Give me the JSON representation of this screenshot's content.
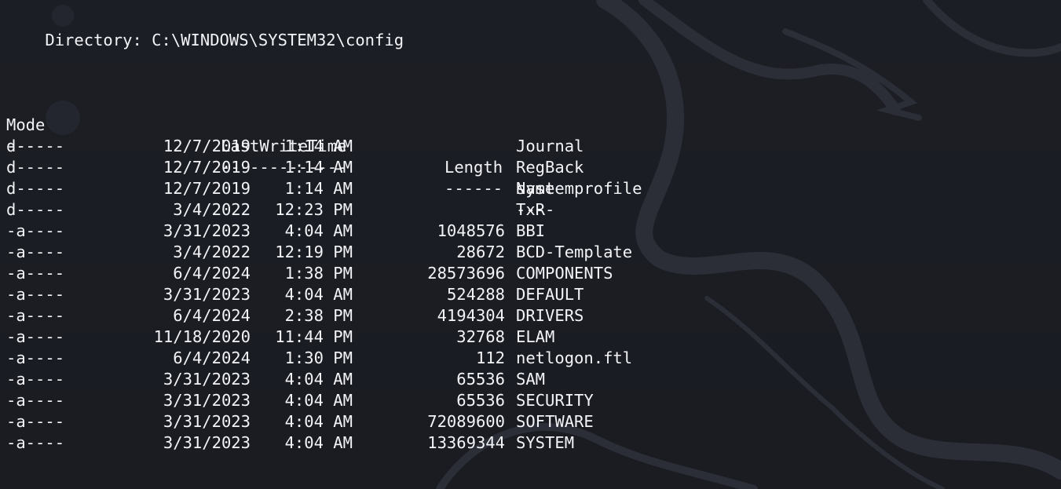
{
  "directory_line": {
    "label": "Directory:",
    "path": "C:\\WINDOWS\\SYSTEM32\\config"
  },
  "headers": {
    "mode": "Mode",
    "lastwritetime": "LastWriteTime",
    "length": "Length",
    "name": "Name"
  },
  "underlines": {
    "mode": "----",
    "lastwritetime": "-------------",
    "length": "------",
    "name": "----"
  },
  "rows": [
    {
      "mode": "d-----",
      "date": "12/7/2019",
      "time": "1:14 AM",
      "length": "",
      "name": "Journal"
    },
    {
      "mode": "d-----",
      "date": "12/7/2019",
      "time": "1:14 AM",
      "length": "",
      "name": "RegBack"
    },
    {
      "mode": "d-----",
      "date": "12/7/2019",
      "time": "1:14 AM",
      "length": "",
      "name": "systemprofile"
    },
    {
      "mode": "d-----",
      "date": "3/4/2022",
      "time": "12:23 PM",
      "length": "",
      "name": "TxR"
    },
    {
      "mode": "-a----",
      "date": "3/31/2023",
      "time": "4:04 AM",
      "length": "1048576",
      "name": "BBI"
    },
    {
      "mode": "-a----",
      "date": "3/4/2022",
      "time": "12:19 PM",
      "length": "28672",
      "name": "BCD-Template"
    },
    {
      "mode": "-a----",
      "date": "6/4/2024",
      "time": "1:38 PM",
      "length": "28573696",
      "name": "COMPONENTS"
    },
    {
      "mode": "-a----",
      "date": "3/31/2023",
      "time": "4:04 AM",
      "length": "524288",
      "name": "DEFAULT"
    },
    {
      "mode": "-a----",
      "date": "6/4/2024",
      "time": "2:38 PM",
      "length": "4194304",
      "name": "DRIVERS"
    },
    {
      "mode": "-a----",
      "date": "11/18/2020",
      "time": "11:44 PM",
      "length": "32768",
      "name": "ELAM"
    },
    {
      "mode": "-a----",
      "date": "6/4/2024",
      "time": "1:30 PM",
      "length": "112",
      "name": "netlogon.ftl"
    },
    {
      "mode": "-a----",
      "date": "3/31/2023",
      "time": "4:04 AM",
      "length": "65536",
      "name": "SAM"
    },
    {
      "mode": "-a----",
      "date": "3/31/2023",
      "time": "4:04 AM",
      "length": "65536",
      "name": "SECURITY"
    },
    {
      "mode": "-a----",
      "date": "3/31/2023",
      "time": "4:04 AM",
      "length": "72089600",
      "name": "SOFTWARE"
    },
    {
      "mode": "-a----",
      "date": "3/31/2023",
      "time": "4:04 AM",
      "length": "13369344",
      "name": "SYSTEM"
    }
  ],
  "colors": {
    "background": "#1b1d24",
    "text": "#f2f4f7"
  }
}
